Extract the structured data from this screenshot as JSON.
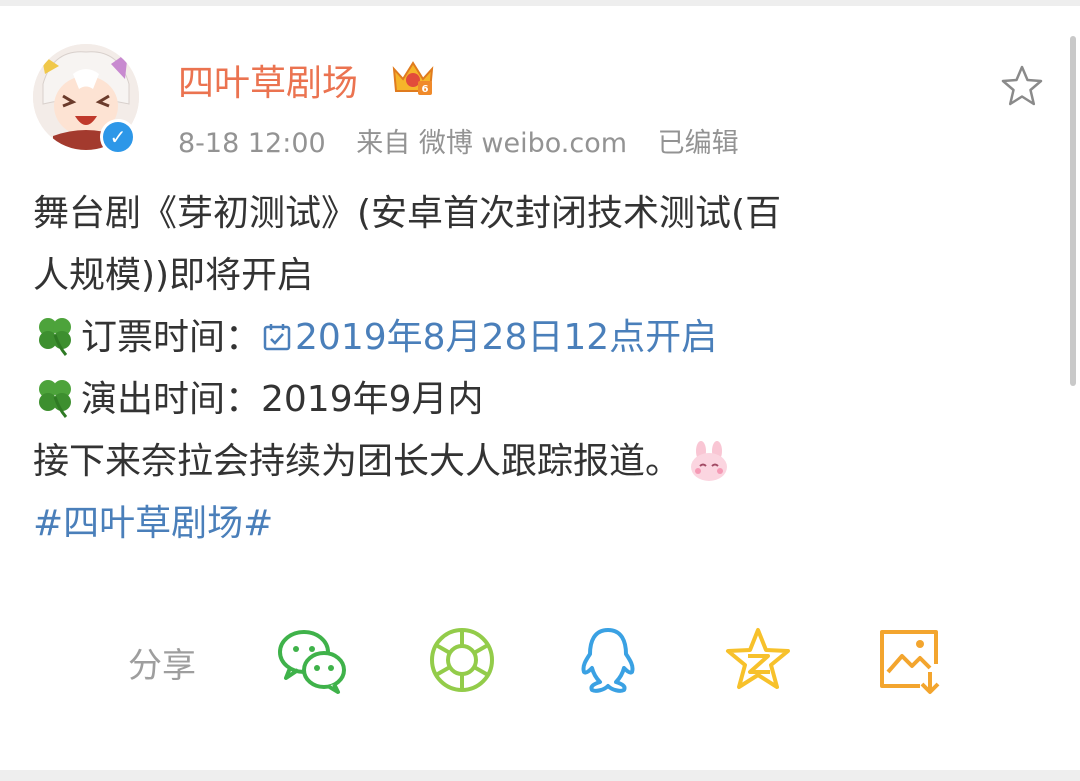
{
  "post": {
    "username": "四叶草剧场",
    "timestamp": "8-18 12:00",
    "source": "来自 微博 weibo.com",
    "edited": "已编辑",
    "lines": {
      "l1": "舞台剧《芽初测试》(安卓首次封闭技术测试(百",
      "l2": "人规模))即将开启",
      "l3_label": "订票时间：",
      "l3_link": "2019年8月28日12点开启",
      "l4": "演出时间：2019年9月内",
      "l5": "接下来奈拉会持续为团长大人跟踪报道。",
      "hashtag": "#四叶草剧场#"
    }
  },
  "share": {
    "label": "分享",
    "buttons": [
      "wechat-icon",
      "moments-icon",
      "qq-icon",
      "qzone-icon",
      "save-image-icon"
    ]
  },
  "colors": {
    "username": "#eb7350",
    "link": "#4a7fba",
    "verified": "#2d97e8",
    "wechat": "#3fb24a",
    "moments": "#93cc4a",
    "qq": "#3aa1e3",
    "qzone": "#f7c12b",
    "save": "#f3a52e"
  }
}
